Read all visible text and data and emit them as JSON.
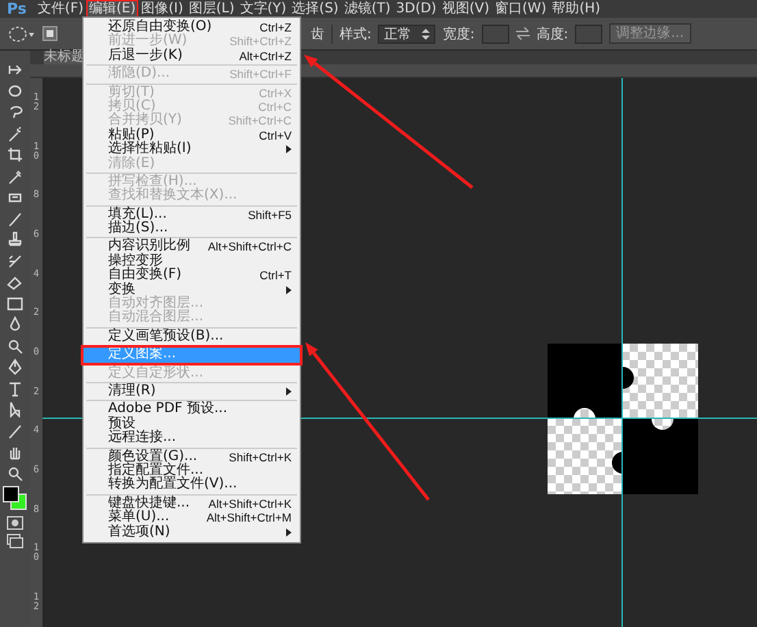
{
  "menubar": {
    "logo": "Ps",
    "items": [
      {
        "label": "文件(F)",
        "selected": false
      },
      {
        "label": "编辑(E)",
        "selected": true
      },
      {
        "label": "图像(I)",
        "selected": false
      },
      {
        "label": "图层(L)",
        "selected": false
      },
      {
        "label": "文字(Y)",
        "selected": false
      },
      {
        "label": "选择(S)",
        "selected": false
      },
      {
        "label": "滤镜(T)",
        "selected": false
      },
      {
        "label": "3D(D)",
        "selected": false
      },
      {
        "label": "视图(V)",
        "selected": false
      },
      {
        "label": "窗口(W)",
        "selected": false
      },
      {
        "label": "帮助(H)",
        "selected": false
      }
    ]
  },
  "options_bar": {
    "partial_label": "齿",
    "style_label": "样式:",
    "style_value": "正常",
    "width_label": "宽度:",
    "height_label": "高度:",
    "refine_button": "调整边缘..."
  },
  "document_tab": {
    "title": "未标题"
  },
  "vertical_ruler": {
    "labels": [
      "12",
      "10",
      "8",
      "6",
      "4",
      "2",
      "0",
      "2",
      "4",
      "6",
      "8",
      "10",
      "12"
    ]
  },
  "edit_menu": {
    "items": [
      {
        "kind": "item",
        "label": "还原自由变换(O)",
        "shortcut": "Ctrl+Z",
        "disabled": false,
        "submenu": false,
        "selected": false
      },
      {
        "kind": "item",
        "label": "前进一步(W)",
        "shortcut": "Shift+Ctrl+Z",
        "disabled": true,
        "submenu": false,
        "selected": false
      },
      {
        "kind": "item",
        "label": "后退一步(K)",
        "shortcut": "Alt+Ctrl+Z",
        "disabled": false,
        "submenu": false,
        "selected": false
      },
      {
        "kind": "separator"
      },
      {
        "kind": "item",
        "label": "渐隐(D)...",
        "shortcut": "Shift+Ctrl+F",
        "disabled": true,
        "submenu": false,
        "selected": false
      },
      {
        "kind": "separator"
      },
      {
        "kind": "item",
        "label": "剪切(T)",
        "shortcut": "Ctrl+X",
        "disabled": true,
        "submenu": false,
        "selected": false
      },
      {
        "kind": "item",
        "label": "拷贝(C)",
        "shortcut": "Ctrl+C",
        "disabled": true,
        "submenu": false,
        "selected": false
      },
      {
        "kind": "item",
        "label": "合并拷贝(Y)",
        "shortcut": "Shift+Ctrl+C",
        "disabled": true,
        "submenu": false,
        "selected": false
      },
      {
        "kind": "item",
        "label": "粘贴(P)",
        "shortcut": "Ctrl+V",
        "disabled": false,
        "submenu": false,
        "selected": false
      },
      {
        "kind": "item",
        "label": "选择性粘贴(I)",
        "disabled": false,
        "submenu": true,
        "selected": false
      },
      {
        "kind": "item",
        "label": "清除(E)",
        "disabled": true,
        "submenu": false,
        "selected": false
      },
      {
        "kind": "separator"
      },
      {
        "kind": "item",
        "label": "拼写检查(H)...",
        "disabled": true,
        "submenu": false,
        "selected": false
      },
      {
        "kind": "item",
        "label": "查找和替换文本(X)...",
        "disabled": true,
        "submenu": false,
        "selected": false
      },
      {
        "kind": "separator"
      },
      {
        "kind": "item",
        "label": "填充(L)...",
        "shortcut": "Shift+F5",
        "disabled": false,
        "submenu": false,
        "selected": false
      },
      {
        "kind": "item",
        "label": "描边(S)...",
        "disabled": false,
        "submenu": false,
        "selected": false
      },
      {
        "kind": "separator"
      },
      {
        "kind": "item",
        "label": "内容识别比例",
        "shortcut": "Alt+Shift+Ctrl+C",
        "disabled": false,
        "submenu": false,
        "selected": false
      },
      {
        "kind": "item",
        "label": "操控变形",
        "disabled": false,
        "submenu": false,
        "selected": false
      },
      {
        "kind": "item",
        "label": "自由变换(F)",
        "shortcut": "Ctrl+T",
        "disabled": false,
        "submenu": false,
        "selected": false
      },
      {
        "kind": "item",
        "label": "变换",
        "disabled": false,
        "submenu": true,
        "selected": false
      },
      {
        "kind": "item",
        "label": "自动对齐图层...",
        "disabled": true,
        "submenu": false,
        "selected": false
      },
      {
        "kind": "item",
        "label": "自动混合图层...",
        "disabled": true,
        "submenu": false,
        "selected": false
      },
      {
        "kind": "separator"
      },
      {
        "kind": "item",
        "label": "定义画笔预设(B)...",
        "disabled": false,
        "submenu": false,
        "selected": false
      },
      {
        "kind": "item",
        "label": "定义图案...",
        "disabled": false,
        "submenu": false,
        "selected": true
      },
      {
        "kind": "item",
        "label": "定义自定形状...",
        "disabled": true,
        "submenu": false,
        "selected": false
      },
      {
        "kind": "separator"
      },
      {
        "kind": "item",
        "label": "清理(R)",
        "disabled": false,
        "submenu": true,
        "selected": false
      },
      {
        "kind": "separator"
      },
      {
        "kind": "item",
        "label": "Adobe PDF 预设...",
        "disabled": false,
        "submenu": false,
        "selected": false
      },
      {
        "kind": "item",
        "label": "预设",
        "disabled": false,
        "submenu": false,
        "selected": false
      },
      {
        "kind": "item",
        "label": "远程连接...",
        "disabled": false,
        "submenu": false,
        "selected": false
      },
      {
        "kind": "separator"
      },
      {
        "kind": "item",
        "label": "颜色设置(G)...",
        "shortcut": "Shift+Ctrl+K",
        "disabled": false,
        "submenu": false,
        "selected": false
      },
      {
        "kind": "item",
        "label": "指定配置文件...",
        "disabled": false,
        "submenu": false,
        "selected": false
      },
      {
        "kind": "item",
        "label": "转换为配置文件(V)...",
        "disabled": false,
        "submenu": false,
        "selected": false
      },
      {
        "kind": "separator"
      },
      {
        "kind": "item",
        "label": "键盘快捷键...",
        "shortcut": "Alt+Shift+Ctrl+K",
        "disabled": false,
        "submenu": false,
        "selected": false
      },
      {
        "kind": "item",
        "label": "菜单(U)...",
        "shortcut": "Alt+Shift+Ctrl+M",
        "disabled": false,
        "submenu": false,
        "selected": false
      },
      {
        "kind": "item",
        "label": "首选项(N)",
        "disabled": false,
        "submenu": true,
        "selected": false
      }
    ]
  }
}
